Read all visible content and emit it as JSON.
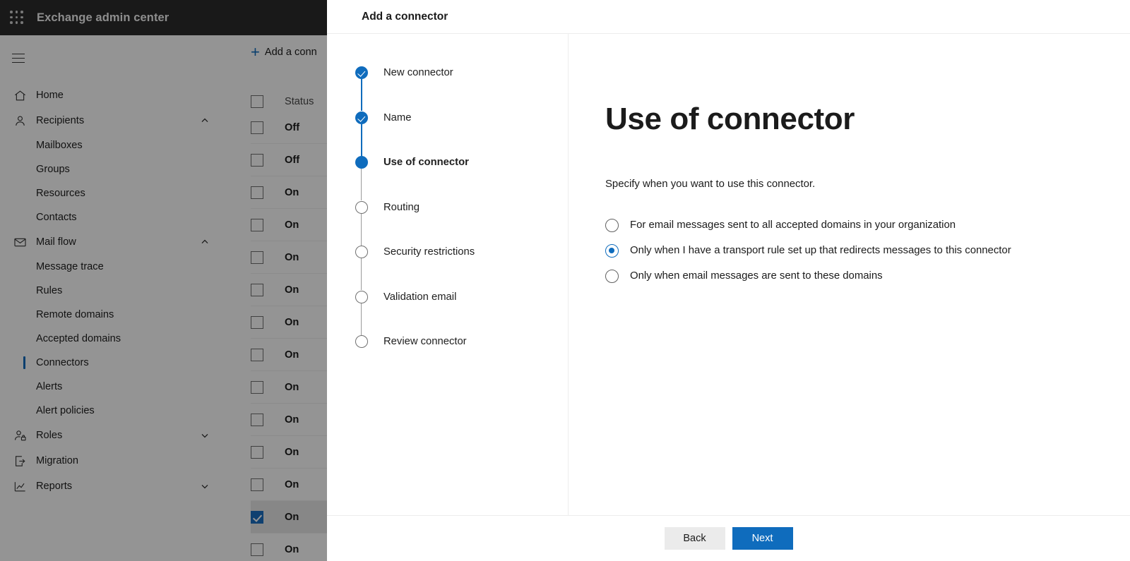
{
  "suite": {
    "app_launcher_icon": "waffle-grid-icon",
    "title": "Exchange admin center"
  },
  "sidebar": {
    "menu_icon": "hamburger-icon",
    "items": [
      {
        "label": "Home",
        "icon": "home-icon",
        "type": "top",
        "chevron": ""
      },
      {
        "label": "Recipients",
        "icon": "person-icon",
        "type": "top",
        "chevron": "chevron-up-icon"
      },
      {
        "label": "Mailboxes",
        "type": "sub"
      },
      {
        "label": "Groups",
        "type": "sub"
      },
      {
        "label": "Resources",
        "type": "sub"
      },
      {
        "label": "Contacts",
        "type": "sub"
      },
      {
        "label": "Mail flow",
        "icon": "envelope-icon",
        "type": "top",
        "chevron": "chevron-up-icon"
      },
      {
        "label": "Message trace",
        "type": "sub"
      },
      {
        "label": "Rules",
        "type": "sub"
      },
      {
        "label": "Remote domains",
        "type": "sub"
      },
      {
        "label": "Accepted domains",
        "type": "sub"
      },
      {
        "label": "Connectors",
        "type": "sub",
        "selected": true
      },
      {
        "label": "Alerts",
        "type": "sub"
      },
      {
        "label": "Alert policies",
        "type": "sub"
      },
      {
        "label": "Roles",
        "icon": "person-lock-icon",
        "type": "top",
        "chevron": "chevron-down-icon"
      },
      {
        "label": "Migration",
        "icon": "migration-icon",
        "type": "top",
        "chevron": ""
      },
      {
        "label": "Reports",
        "icon": "chart-icon",
        "type": "top",
        "chevron": "chevron-down-icon"
      }
    ]
  },
  "background_page": {
    "command_bar": {
      "add_label": "Add a conn",
      "add_icon": "plus-icon"
    },
    "table": {
      "columns": [
        "Status"
      ],
      "rows": [
        {
          "status": "Off",
          "checked": false
        },
        {
          "status": "Off",
          "checked": false
        },
        {
          "status": "On",
          "checked": false
        },
        {
          "status": "On",
          "checked": false
        },
        {
          "status": "On",
          "checked": false
        },
        {
          "status": "On",
          "checked": false
        },
        {
          "status": "On",
          "checked": false
        },
        {
          "status": "On",
          "checked": false
        },
        {
          "status": "On",
          "checked": false
        },
        {
          "status": "On",
          "checked": false
        },
        {
          "status": "On",
          "checked": false
        },
        {
          "status": "On",
          "checked": false
        },
        {
          "status": "On",
          "checked": true
        },
        {
          "status": "On",
          "checked": false
        }
      ]
    }
  },
  "dialog": {
    "title": "Add a connector",
    "steps": [
      {
        "label": "New connector",
        "state": "done"
      },
      {
        "label": "Name",
        "state": "done"
      },
      {
        "label": "Use of connector",
        "state": "current"
      },
      {
        "label": "Routing",
        "state": "todo"
      },
      {
        "label": "Security restrictions",
        "state": "todo"
      },
      {
        "label": "Validation email",
        "state": "todo"
      },
      {
        "label": "Review connector",
        "state": "todo"
      }
    ],
    "heading": "Use of connector",
    "subtitle": "Specify when you want to use this connector.",
    "options": [
      {
        "label": "For email messages sent to all accepted domains in your organization",
        "selected": false
      },
      {
        "label": "Only when I have a transport rule set up that redirects messages to this connector",
        "selected": true
      },
      {
        "label": "Only when email messages are sent to these domains",
        "selected": false
      }
    ],
    "footer": {
      "back_label": "Back",
      "next_label": "Next"
    }
  },
  "colors": {
    "accent": "#0f6cbd",
    "suite_bar": "#2b2b2b",
    "selected_row": "#e8e8e8",
    "checkbox_checked": "#1b6ec2"
  }
}
